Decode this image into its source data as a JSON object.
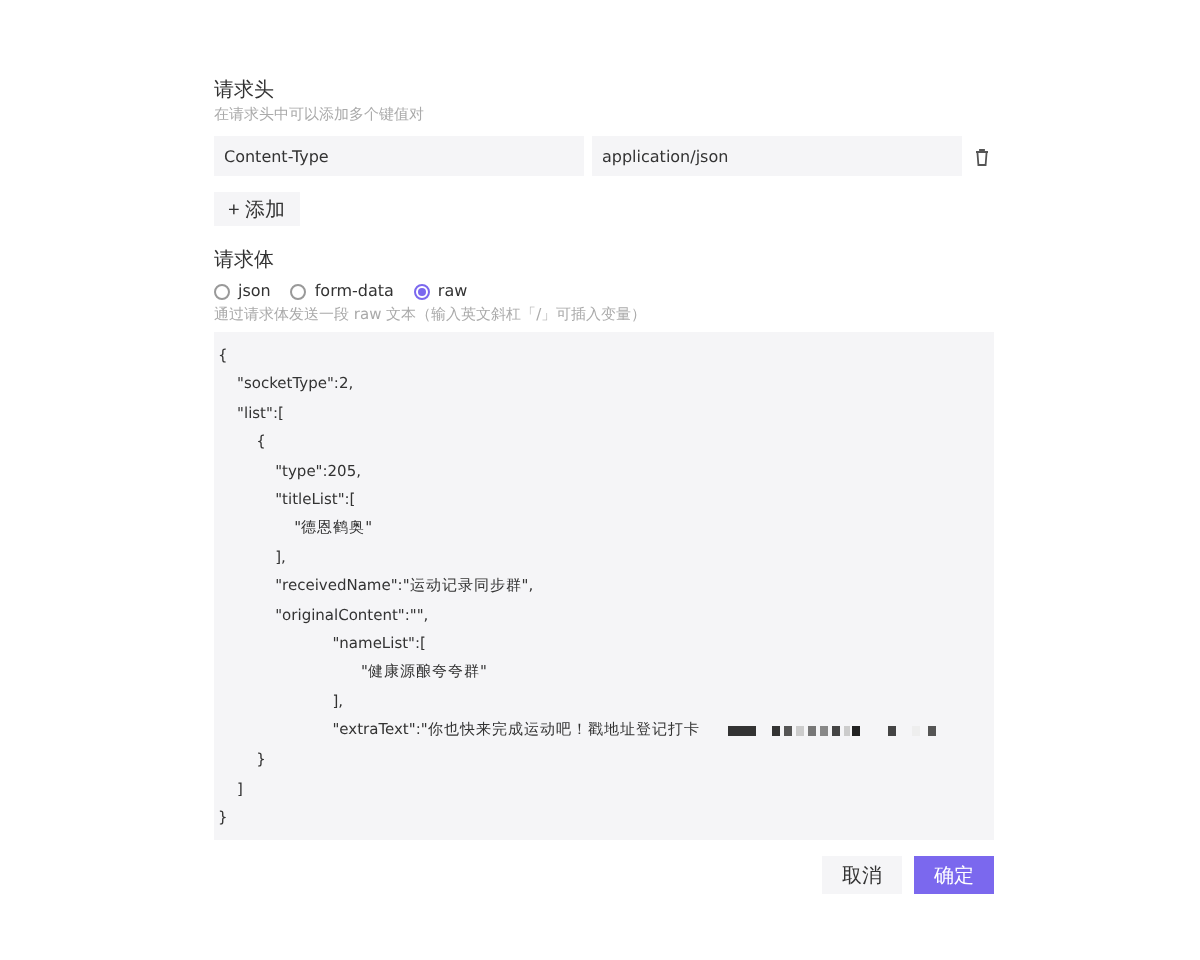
{
  "headers": {
    "title": "请求头",
    "hint": "在请求头中可以添加多个键值对",
    "rows": [
      {
        "key": "Content-Type",
        "value": "application/json"
      }
    ],
    "add_button": "+ 添加"
  },
  "body": {
    "title": "请求体",
    "options": [
      {
        "label": "json",
        "selected": false
      },
      {
        "label": "form-data",
        "selected": false
      },
      {
        "label": "raw",
        "selected": true
      }
    ],
    "hint": "通过请求体发送一段 raw 文本（输入英文斜杠「/」可插入变量）",
    "lines": [
      {
        "text": "{"
      },
      {
        "text": "    \"socketType\":2,"
      },
      {
        "text": "    \"list\":["
      },
      {
        "text": "        {"
      },
      {
        "text": "            \"type\":205,"
      },
      {
        "text": "            \"titleList\":["
      },
      {
        "text": "                \"德恩鹤奥\""
      },
      {
        "text": "            ],"
      },
      {
        "text": "            \"receivedName\":\"运动记录同步群\","
      },
      {
        "text": "            \"originalContent\":\"\","
      },
      {
        "text": "                        \"nameList\":["
      },
      {
        "text": "                              \"健康源酿夸夸群\""
      },
      {
        "text": "                        ],"
      },
      {
        "text": "                        \"extraText\":\"你也快来完成运动吧！戳地址登记打卡",
        "redacted": true
      },
      {
        "text": "        }"
      },
      {
        "text": "    ]"
      },
      {
        "text": "}"
      }
    ]
  },
  "buttons": [
    {
      "label": "取消",
      "kind": "secondary"
    },
    {
      "label": "确定",
      "kind": "primary"
    }
  ]
}
